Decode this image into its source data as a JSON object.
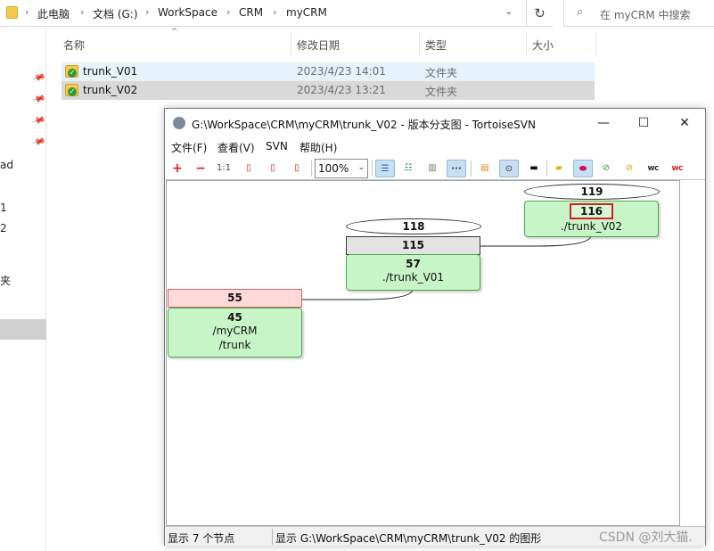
{
  "explorer": {
    "breadcrumb": [
      "此电脑",
      "文档 (G:)",
      "WorkSpace",
      "CRM",
      "myCRM"
    ],
    "search_placeholder": "在 myCRM 中搜索",
    "columns": {
      "name": "名称",
      "date": "修改日期",
      "type": "类型",
      "size": "大小"
    },
    "files": [
      {
        "name": "trunk_V01",
        "date": "2023/4/23 14:01",
        "type": "文件夹"
      },
      {
        "name": "trunk_V02",
        "date": "2023/4/23 13:21",
        "type": "文件夹"
      }
    ],
    "nav_fragments": [
      "ad",
      "1",
      "2",
      "夹"
    ]
  },
  "svn": {
    "title": "G:\\WorkSpace\\CRM\\myCRM\\trunk_V02 - 版本分支图 - TortoiseSVN",
    "menu": [
      "文件(F)",
      "查看(V)",
      "SVN",
      "帮助(H)"
    ],
    "zoom": "100%",
    "graph": {
      "nodes": [
        {
          "id": "n119",
          "kind": "ellipse",
          "label": "119"
        },
        {
          "id": "n116",
          "kind": "green",
          "rev": "116",
          "path": "./trunk_V02",
          "highlighted": true
        },
        {
          "id": "n118",
          "kind": "ellipse",
          "label": "118"
        },
        {
          "id": "n115",
          "kind": "gray",
          "label": "115"
        },
        {
          "id": "n57",
          "kind": "green",
          "rev": "57",
          "path": "./trunk_V01"
        },
        {
          "id": "n55",
          "kind": "pink",
          "label": "55"
        },
        {
          "id": "n45",
          "kind": "green",
          "rev": "45",
          "path": "/myCRM",
          "path2": "/trunk"
        }
      ]
    },
    "status": {
      "left": "显示 7 个节点",
      "right": "显示 G:\\WorkSpace\\CRM\\myCRM\\trunk_V02 的图形"
    }
  },
  "watermark": "CSDN @刘大猫."
}
